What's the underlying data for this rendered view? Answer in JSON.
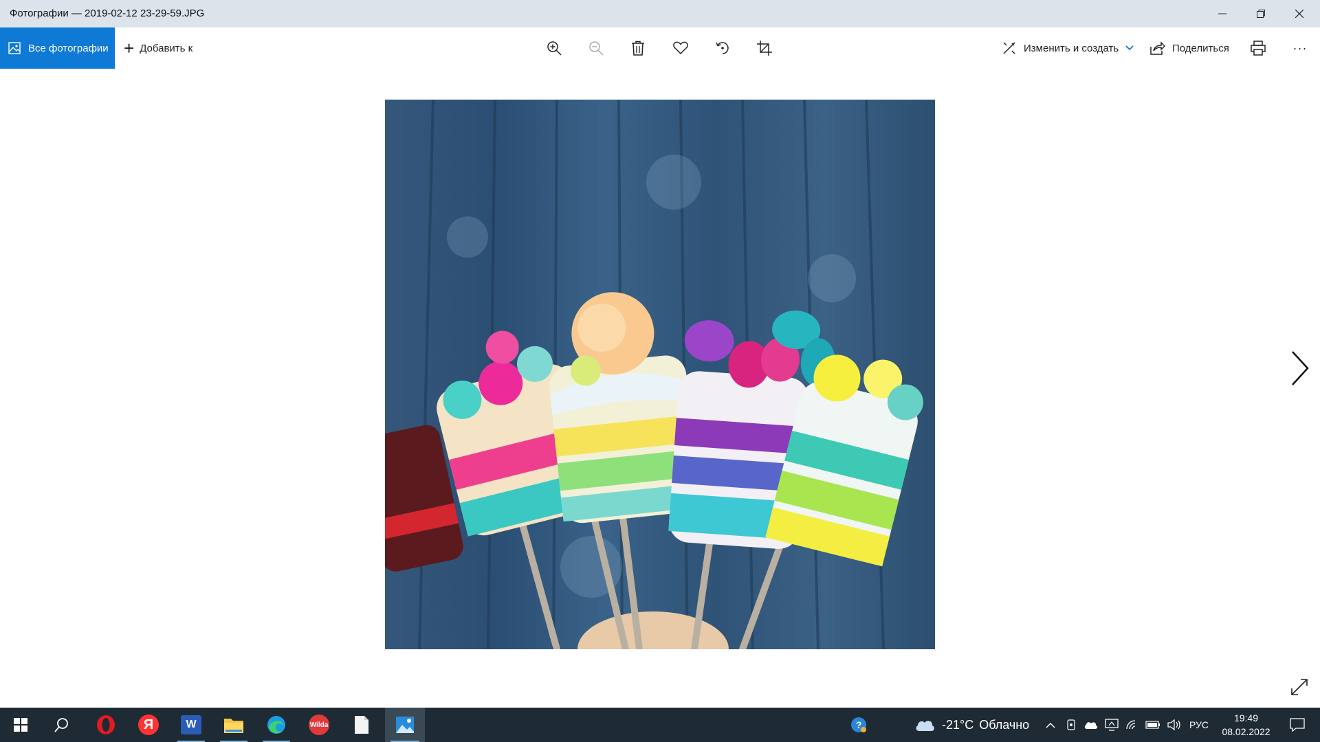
{
  "window": {
    "title": "Фотографии — 2019-02-12 23-29-59.JPG",
    "controls": [
      "minimize-icon",
      "restore-icon",
      "close-icon"
    ]
  },
  "toolbar": {
    "all_photos_label": "Все фотографии",
    "add_to_label": "Добавить к",
    "tools": [
      "zoom-in-icon",
      "zoom-out-icon",
      "delete-icon",
      "favorite-heart-icon",
      "rotate-icon",
      "crop-icon"
    ],
    "edit_create_label": "Изменить и создать",
    "share_label": "Поделиться",
    "print_icon": "print-icon",
    "more_label": "···"
  },
  "viewer": {
    "next_icon": "chevron-right-icon",
    "fullscreen_icon": "expand-icon"
  },
  "taskbar": {
    "apps": [
      "windows-start-icon",
      "search-icon",
      "opera-icon",
      "yandex-icon",
      "word-icon",
      "file-explorer-icon",
      "edge-icon",
      "wilda-icon",
      "notepad-icon",
      "photos-icon"
    ],
    "wilda_label": "Wilda",
    "yandex_label": "Я",
    "word_label": "W",
    "weather": {
      "temp": "-21°C",
      "desc": "Облачно"
    },
    "language": "РУС",
    "time": "19:49",
    "date": "08.02.2022"
  },
  "colors": {
    "accent": "#0f79d6",
    "titlebar": "#dde3eb",
    "taskbar": "#1e2a34"
  }
}
